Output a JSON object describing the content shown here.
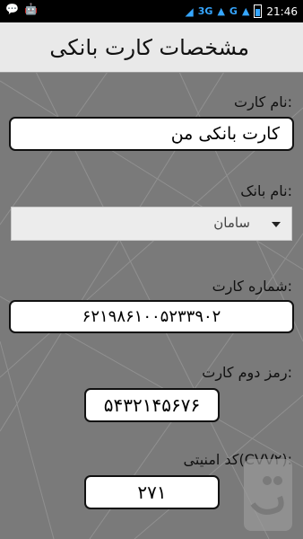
{
  "status": {
    "signal_1": "3G",
    "signal_2": "G",
    "time": "21:46"
  },
  "header": {
    "title": "مشخصات کارت بانکی"
  },
  "form": {
    "card_name_label": "نام کارت:",
    "card_name_value": "کارت بانکی من",
    "bank_label": "نام بانک:",
    "bank_selected": "سامان",
    "card_number_label": "شماره کارت:",
    "card_number_value": "۶۲۱۹۸۶۱۰۰۵۲۳۳۹۰۲",
    "second_password_label": "رمز دوم کارت:",
    "second_password_value": "۵۴۳۲۱۴۵۶۷۶",
    "cvv2_label": "کد امنیتی(CVV۲):",
    "cvv2_value": "۲۷۱"
  }
}
